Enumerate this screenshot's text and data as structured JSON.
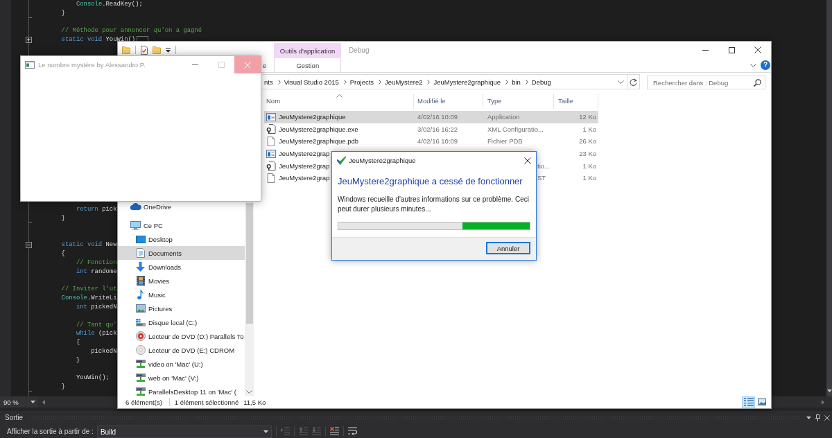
{
  "editor": {
    "blocks": [
      {
        "lines": [
          {
            "kind": "code",
            "tokens": [
              {
                "kind": "type",
                "text": "            Console"
              },
              {
                "kind": "plain",
                "text": ".ReadKey();"
              }
            ]
          },
          {
            "kind": "code",
            "block_end": true,
            "tokens": [
              {
                "kind": "plain",
                "text": "        }"
              }
            ]
          },
          {
            "kind": "blank"
          },
          {
            "kind": "code",
            "tokens": [
              {
                "kind": "comment",
                "text": "        // Méthode pour annoncer qu'on a gagné"
              }
            ]
          },
          {
            "kind": "code",
            "expanded": false,
            "tokens": [
              {
                "kind": "keyword",
                "text": "        static void"
              },
              {
                "kind": "plain",
                "text": " YouWin()"
              }
            ]
          }
        ]
      },
      {
        "lines": [
          {
            "kind": "code",
            "tokens": [
              {
                "kind": "keyword",
                "text": "            return"
              },
              {
                "kind": "plain",
                "text": " pick"
              }
            ]
          },
          {
            "kind": "code",
            "block_end": true,
            "tokens": [
              {
                "kind": "plain",
                "text": "        }"
              }
            ]
          },
          {
            "kind": "blank"
          },
          {
            "kind": "blank"
          },
          {
            "kind": "code",
            "expanded": true,
            "tokens": [
              {
                "kind": "keyword",
                "text": "        static void"
              },
              {
                "kind": "plain",
                "text": " New"
              }
            ]
          },
          {
            "kind": "code",
            "tokens": [
              {
                "kind": "plain",
                "text": "        {"
              }
            ]
          },
          {
            "kind": "code",
            "tokens": [
              {
                "kind": "comment",
                "text": "            // Fonction"
              }
            ]
          },
          {
            "kind": "code",
            "tokens": [
              {
                "kind": "keyword",
                "text": "            int"
              },
              {
                "kind": "plain",
                "text": " randome"
              }
            ]
          },
          {
            "kind": "blank"
          },
          {
            "kind": "code",
            "tokens": [
              {
                "kind": "comment",
                "text": "        // Inviter l'ut"
              }
            ]
          },
          {
            "kind": "code",
            "tokens": [
              {
                "kind": "type",
                "text": "        Console"
              },
              {
                "kind": "plain",
                "text": ".WriteLi"
              }
            ]
          },
          {
            "kind": "code",
            "tokens": [
              {
                "kind": "keyword",
                "text": "            int"
              },
              {
                "kind": "plain",
                "text": " pickedN"
              }
            ]
          },
          {
            "kind": "blank"
          },
          {
            "kind": "code",
            "tokens": [
              {
                "kind": "comment",
                "text": "            // Tant qu'"
              }
            ]
          },
          {
            "kind": "code",
            "tokens": [
              {
                "kind": "keyword",
                "text": "            while"
              },
              {
                "kind": "plain",
                "text": " (pick"
              }
            ]
          },
          {
            "kind": "code",
            "tokens": [
              {
                "kind": "plain",
                "text": "            {"
              }
            ]
          },
          {
            "kind": "code",
            "tokens": [
              {
                "kind": "plain",
                "text": "                pickedN"
              }
            ]
          },
          {
            "kind": "code",
            "tokens": [
              {
                "kind": "plain",
                "text": "            }"
              }
            ]
          },
          {
            "kind": "blank"
          },
          {
            "kind": "code",
            "tokens": [
              {
                "kind": "plain",
                "text": "            YouWin();"
              }
            ]
          },
          {
            "kind": "code",
            "block_end": true,
            "tokens": [
              {
                "kind": "plain",
                "text": "        }"
              }
            ]
          }
        ]
      }
    ],
    "zoom": "90 %"
  },
  "output_panel": {
    "title": "Sortie",
    "source_label": "Afficher la sortie à partir de :",
    "source": "Build",
    "tools": [
      {
        "kind": "find",
        "disabled": true
      },
      {
        "kind": "previous",
        "disabled": true
      },
      {
        "kind": "next",
        "disabled": true
      },
      {
        "kind": "clear",
        "disabled": false
      },
      {
        "kind": "wrap",
        "disabled": false
      }
    ]
  },
  "explorer": {
    "title": "Debug",
    "tabs": [
      {
        "label": "e",
        "selected": false
      }
    ],
    "context_group": {
      "label": "Outils d'application",
      "tabs": [
        {
          "label": "Gestion",
          "selected": false
        }
      ]
    },
    "help": "?",
    "breadcrumb": [
      "nts",
      "Visual Studio 2015",
      "Projects",
      "JeuMystere2",
      "JeuMystere2graphique",
      "bin",
      "Debug"
    ],
    "search": {
      "placeholder": "Rechercher dans : Debug"
    },
    "nav": [
      {
        "label": "OneDrive",
        "kind": "cloud",
        "selected": false
      },
      {
        "label": "Ce PC",
        "kind": "computer",
        "selected": false,
        "children": [
          {
            "label": "Desktop",
            "kind": "desktop",
            "selected": false
          },
          {
            "label": "Documents",
            "kind": "documents",
            "selected": true
          },
          {
            "label": "Downloads",
            "kind": "downloads",
            "selected": false
          },
          {
            "label": "Movies",
            "kind": "movies",
            "selected": false
          },
          {
            "label": "Music",
            "kind": "music",
            "selected": false
          },
          {
            "label": "Pictures",
            "kind": "pictures",
            "selected": false
          },
          {
            "label": "Disque local (C:)",
            "kind": "drive",
            "selected": false
          },
          {
            "label": "Lecteur de DVD (D:) Parallels To",
            "kind": "tools_disc",
            "selected": false
          },
          {
            "label": "Lecteur de DVD (E:) CDROM",
            "kind": "disc",
            "selected": false
          },
          {
            "label": "video on 'Mac' (U:)",
            "kind": "network_drive",
            "selected": false
          },
          {
            "label": "web on 'Mac' (V:)",
            "kind": "network_drive",
            "selected": false
          },
          {
            "label": "ParallelsDesktop 11 on 'Mac' (",
            "kind": "network_drive",
            "selected": false
          }
        ]
      }
    ],
    "columns": [
      {
        "label": "Nom",
        "sorted": true
      },
      {
        "label": "Modifié le",
        "sorted": false
      },
      {
        "label": "Type",
        "sorted": false
      },
      {
        "label": "Taille",
        "sorted": false
      }
    ],
    "rows": [
      {
        "kind": "application",
        "name": "JeuMystere2graphique",
        "modified": "4/02/16 10:09",
        "type": "Application",
        "size": "12 Ko",
        "selected": true
      },
      {
        "kind": "config",
        "name": "JeuMystere2graphique.exe",
        "modified": "3/02/16 16:22",
        "type": "XML Configuratio...",
        "size": "1 Ko",
        "selected": false
      },
      {
        "kind": "document",
        "name": "JeuMystere2graphique.pdb",
        "modified": "4/02/16 10:09",
        "type": "Fichier PDB",
        "size": "26 Ko",
        "selected": false
      },
      {
        "kind": "application",
        "name": "JeuMystere2grap",
        "size": "23 Ko",
        "selected": false
      },
      {
        "kind": "config",
        "name": "JeuMystere2grap",
        "type": "tio...",
        "type_clipped": true,
        "size": "1 Ko",
        "selected": false
      },
      {
        "kind": "document",
        "name": "JeuMystere2grap",
        "type": "ST",
        "type_clipped": true,
        "size": "1 Ko",
        "selected": false
      }
    ],
    "status": {
      "count": "6 élément(s)",
      "selection": "1 élément sélectionné",
      "size": "11,5 Ko"
    },
    "views": [
      {
        "kind": "details",
        "selected": true
      },
      {
        "kind": "large_icons",
        "selected": false
      }
    ]
  },
  "app_window": {
    "title": "Le nombre mystère by Alessandro P.",
    "controls": [
      {
        "kind": "minimize",
        "disabled": false,
        "highlighted": false
      },
      {
        "kind": "maximize",
        "disabled": true,
        "highlighted": false
      },
      {
        "kind": "close",
        "disabled": false,
        "highlighted": true
      }
    ]
  },
  "error_dialog": {
    "title": "JeuMystere2graphique",
    "heading": "JeuMystere2graphique a cessé de fonctionner",
    "message": "Windows recueille d'autres informations sur ce problème. Ceci peut durer plusieurs minutes...",
    "progress": {
      "level": 0.35
    },
    "buttons": [
      {
        "label": "Annuler",
        "default": true
      }
    ]
  }
}
